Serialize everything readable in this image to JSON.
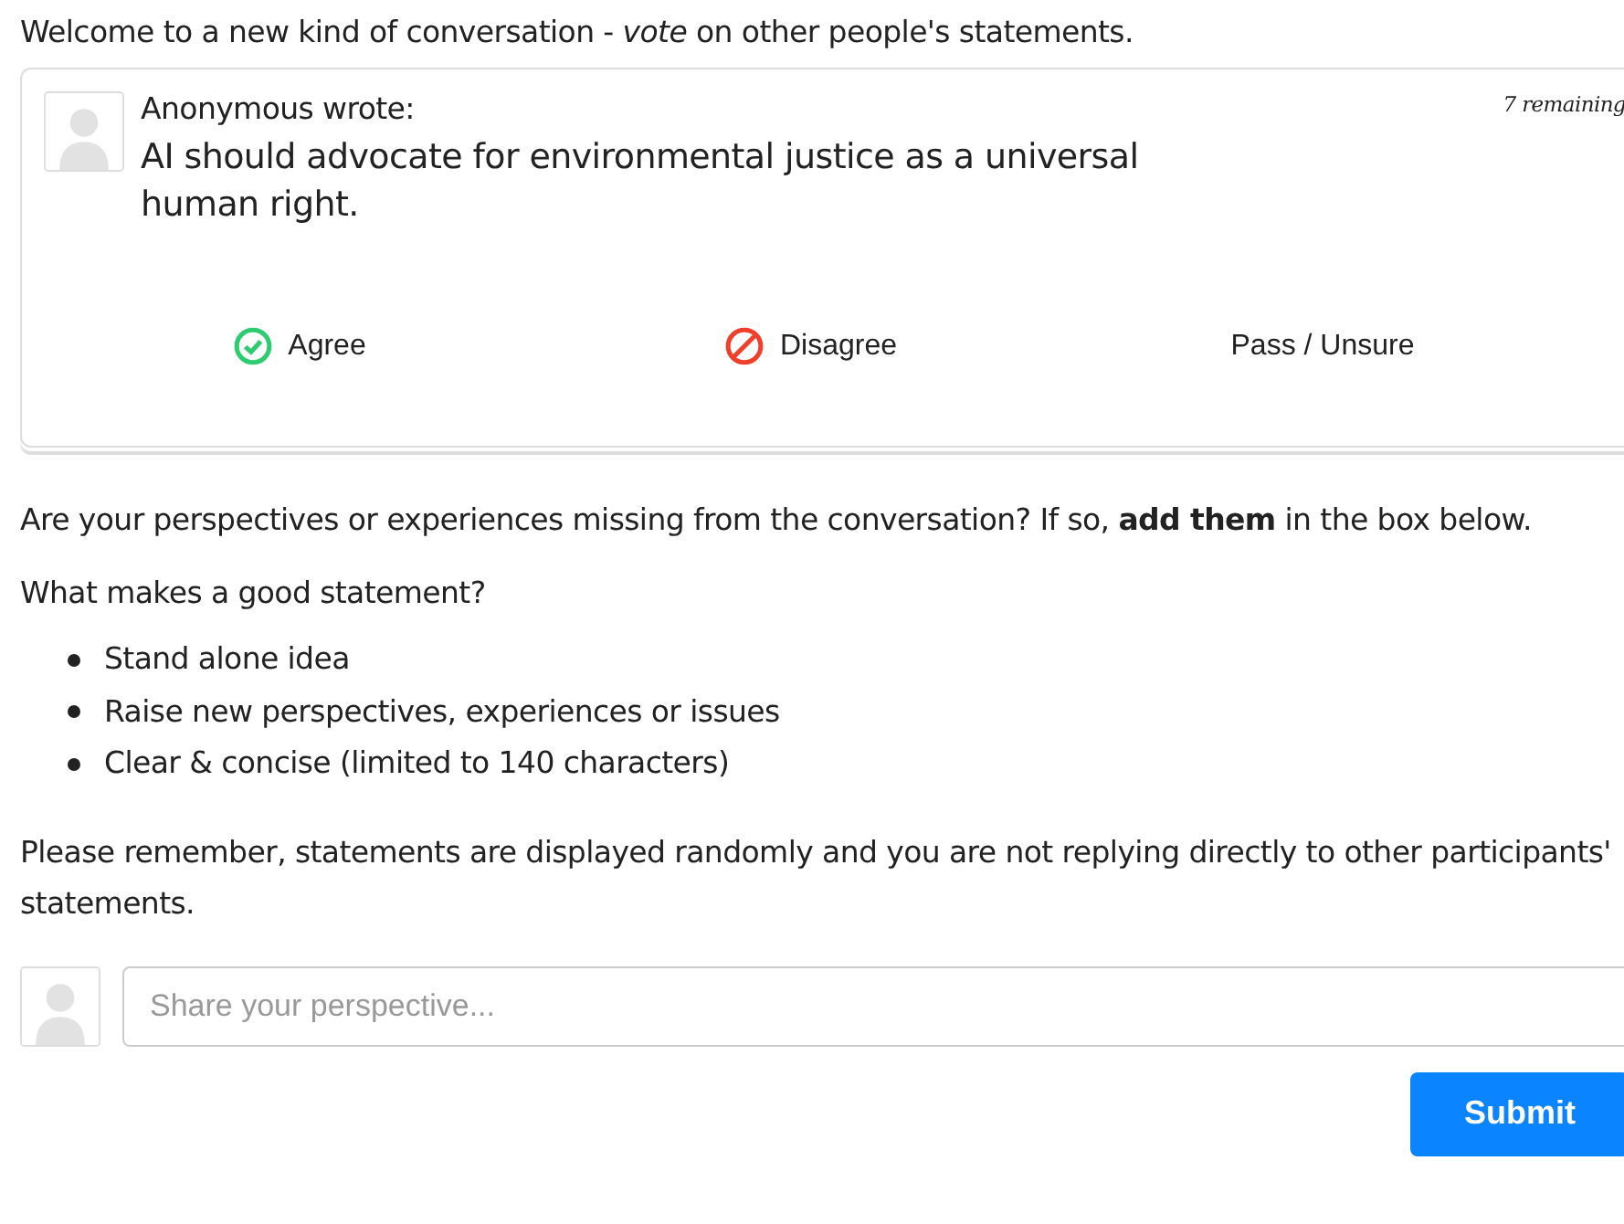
{
  "intro": "Welcome to a new kind of conversation - *vote* on other people's statements.",
  "card": {
    "author": "Anonymous wrote:",
    "remaining": "7 remaining",
    "statement": "AI should advocate for environmental justice as a universal human right.",
    "votes": [
      {
        "kind": "agree",
        "label": "Agree"
      },
      {
        "kind": "disagree",
        "label": "Disagree"
      },
      {
        "kind": "pass",
        "label": "Pass / Unsure"
      }
    ]
  },
  "prompt": "Are your perspectives or experiences missing from the conversation? If so, **add them** in the box below.",
  "guide_title": "What makes a good statement?",
  "guide_items": [
    "Stand alone idea",
    "Raise new perspectives, experiences or issues",
    "Clear & concise (limited to 140 characters)"
  ],
  "reminder": "Please remember, statements are displayed randomly and you are not replying directly to other participants' statements.",
  "compose": {
    "placeholder": "Share your perspective..."
  },
  "submit": "Submit"
}
